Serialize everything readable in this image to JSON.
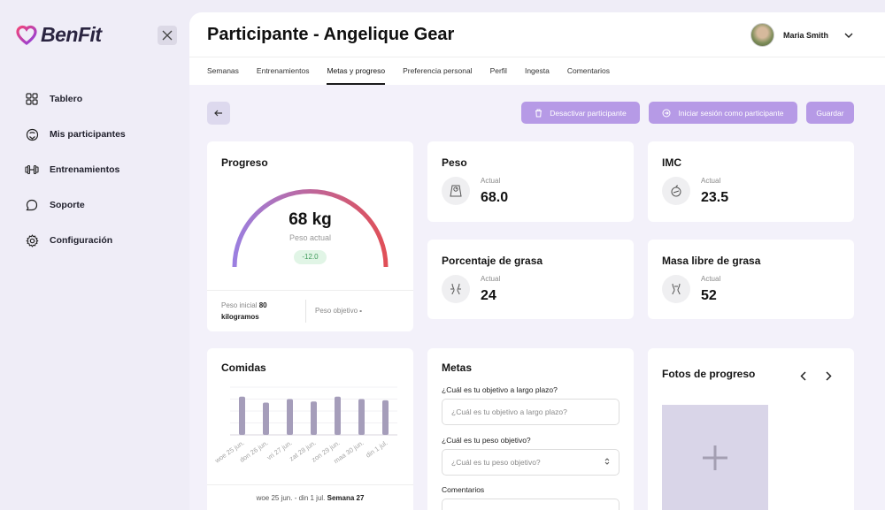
{
  "brand": {
    "name": "BenFit"
  },
  "sidebar": {
    "items": [
      {
        "label": "Tablero",
        "icon": "grid-icon"
      },
      {
        "label": "Mis participantes",
        "icon": "participants-icon"
      },
      {
        "label": "Entrenamientos",
        "icon": "dumbbell-icon"
      },
      {
        "label": "Soporte",
        "icon": "chat-icon"
      },
      {
        "label": "Configuración",
        "icon": "gear-icon"
      }
    ]
  },
  "header": {
    "title": "Participante - Angelique Gear",
    "user_name": "Maria Smith"
  },
  "tabs": [
    {
      "label": "Semanas"
    },
    {
      "label": "Entrenamientos"
    },
    {
      "label": "Metas y progreso",
      "active": true
    },
    {
      "label": "Preferencia personal"
    },
    {
      "label": "Perfil"
    },
    {
      "label": "Ingesta"
    },
    {
      "label": "Comentarios"
    }
  ],
  "actions": {
    "deactivate": "Desactivar participante",
    "login_as": "Iniciar sesión como participante",
    "save": "Guardar"
  },
  "progress": {
    "title": "Progreso",
    "value": "68 kg",
    "label": "Peso actual",
    "delta": "-12.0",
    "initial_label": "Peso inicial",
    "initial_value": "80",
    "initial_unit": "kilogramos",
    "goal_label": "Peso objetivo",
    "goal_value": "-"
  },
  "metrics": [
    {
      "title": "Peso",
      "sub": "Actual",
      "value": "68.0",
      "icon": "scale-icon"
    },
    {
      "title": "IMC",
      "sub": "Actual",
      "value": "23.5",
      "icon": "apple-scale-icon"
    },
    {
      "title": "Porcentaje de grasa",
      "sub": "Actual",
      "value": "24",
      "icon": "body-fat-icon"
    },
    {
      "title": "Masa libre de grasa",
      "sub": "Actual",
      "value": "52",
      "icon": "body-mass-icon"
    }
  ],
  "meals": {
    "title": "Comidas",
    "week_range": "woe 25 jun. - din 1 jul.",
    "week_label": "Semana 27"
  },
  "chart_data": {
    "type": "bar",
    "categories": [
      "woe 25 jun.",
      "don 26 jun.",
      "vri 27 jun.",
      "zat 28 jun.",
      "zon 29 jun.",
      "maa 30 jun.",
      "din 1 jul."
    ],
    "values": [
      32,
      27,
      30,
      28,
      32,
      30,
      29
    ],
    "title": "",
    "xlabel": "",
    "ylabel": "",
    "ylim": [
      0,
      40
    ],
    "grid": true
  },
  "goals": {
    "title": "Metas",
    "q1_label": "¿Cuál es tu objetivo a largo plazo?",
    "q1_placeholder": "¿Cuál es tu objetivo a largo plazo?",
    "q2_label": "¿Cuál es tu peso objetivo?",
    "q2_placeholder": "¿Cuál es tu peso objetivo?",
    "comments_label": "Comentarios"
  },
  "photos": {
    "title": "Fotos de progreso"
  },
  "colors": {
    "accent": "#b69ae6",
    "gauge_start": "#9b7fe0",
    "gauge_end": "#e04f57",
    "bar": "#a59dba"
  }
}
